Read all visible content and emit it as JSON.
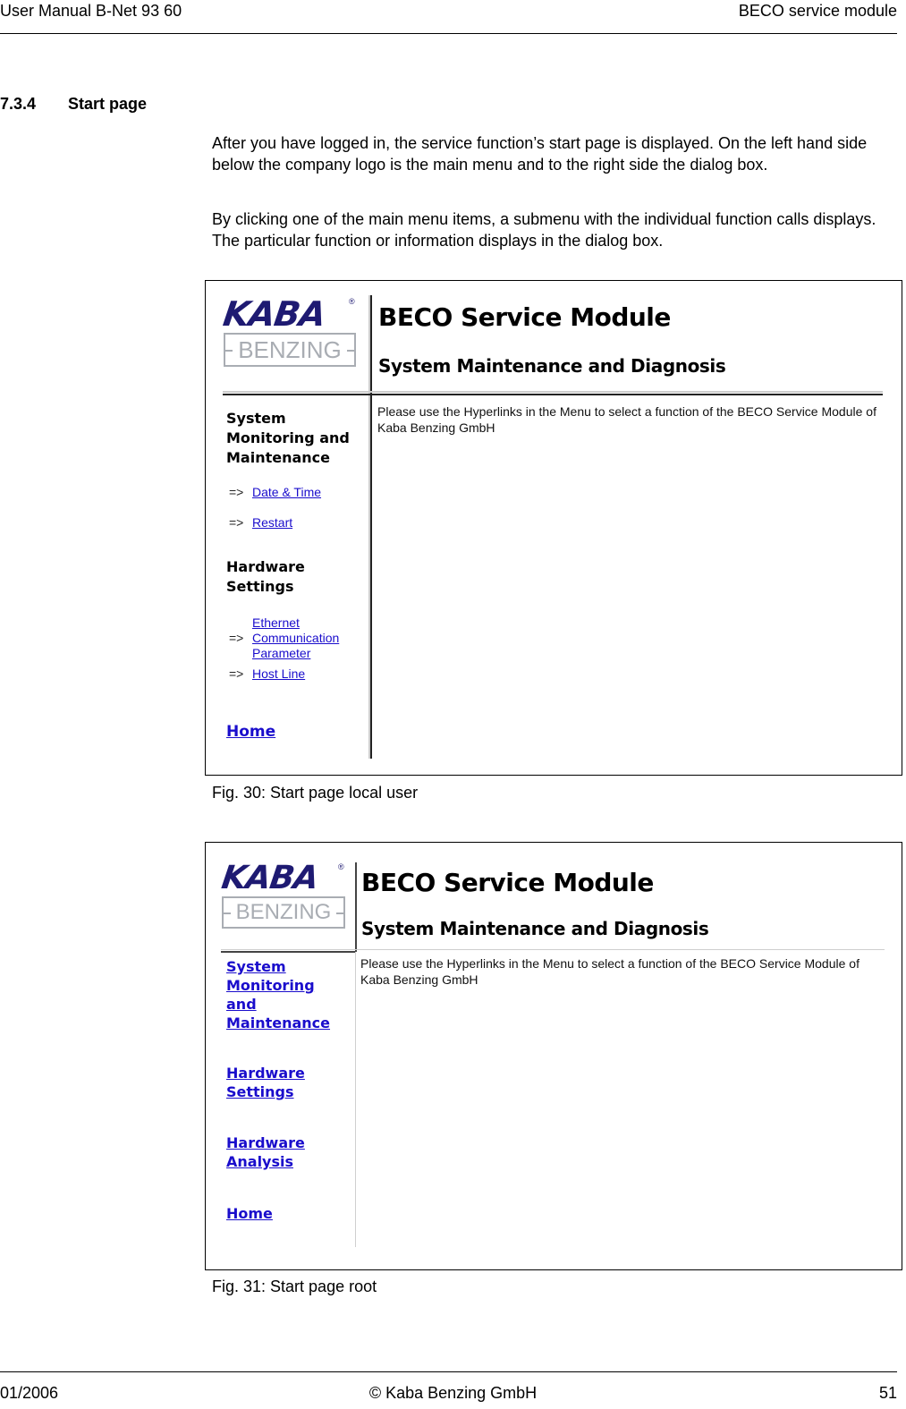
{
  "page_header": {
    "left": "User Manual B-Net 93 60",
    "right": "BECO service module"
  },
  "section": {
    "number": "7.3.4",
    "title": "Start page"
  },
  "paragraphs": [
    "After you have logged in, the service function’s start page is displayed. On the left hand side below the company logo is the main menu and to the right side the dialog box.",
    "By clicking one of the main menu items, a submenu with the individual function calls displays. The particular function or information displays in the dialog box."
  ],
  "colors": {
    "logo_primary": "#1e1a72",
    "logo_secondary": "#a9adb3",
    "link": "#1a0dcc"
  },
  "figures": [
    {
      "caption": "Fig. 30: Start page local user",
      "logo": {
        "brand": "KABA",
        "registered": "®",
        "sub_brand": "BENZING"
      },
      "title": "BECO Service Module",
      "subtitle": "System Maintenance and Diagnosis",
      "message": "Please use the Hyperlinks in the Menu to select a function of the BECO Service Module of Kaba Benzing GmbH",
      "menu": [
        {
          "heading": "System Monitoring and Maintenance",
          "items": [
            {
              "arrow": "=>",
              "label": "Date & Time"
            },
            {
              "arrow": "=>",
              "label": "Restart"
            }
          ]
        },
        {
          "heading": "Hardware Settings",
          "items": [
            {
              "arrow": "=>",
              "label": "Ethernet Communication Parameter"
            },
            {
              "arrow": "=>",
              "label": "Host Line"
            }
          ]
        }
      ],
      "home_label": "Home"
    },
    {
      "caption": "Fig. 31: Start page root",
      "logo": {
        "brand": "KABA",
        "registered": "®",
        "sub_brand": "BENZING"
      },
      "title": "BECO Service Module",
      "subtitle": "System Maintenance and Diagnosis",
      "message": "Please use the Hyperlinks in the Menu to select a function of the BECO Service Module of Kaba Benzing GmbH",
      "menu_links": [
        "System Monitoring and Maintenance",
        "Hardware Settings",
        "Hardware Analysis",
        "Home"
      ]
    }
  ],
  "page_footer": {
    "left": "01/2006",
    "center": "© Kaba Benzing GmbH",
    "right": "51"
  }
}
